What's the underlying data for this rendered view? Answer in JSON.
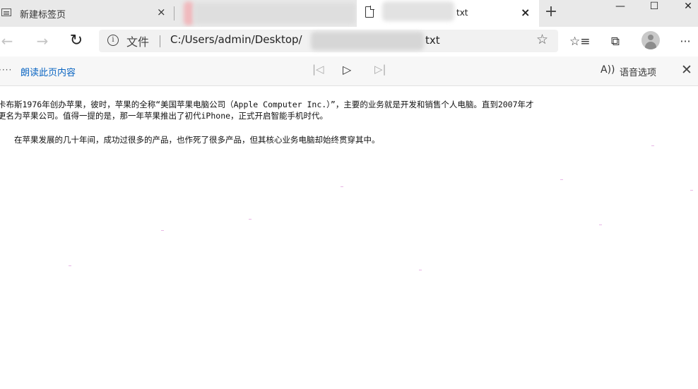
{
  "tabs": [
    {
      "title": "新建标签页",
      "close": "×"
    },
    {
      "title": ""
    },
    {
      "title": "txt",
      "close": "×"
    }
  ],
  "new_tab": "+",
  "window_controls": {
    "minimize": "—",
    "maximize": "☐",
    "close": "✕"
  },
  "toolbar": {
    "back": "←",
    "forward": "→",
    "refresh": "↻",
    "info": "i",
    "file_label": "文件",
    "url": "C:/Users/admin/Desktop/",
    "url_suffix": "txt",
    "star": "☆",
    "favorites": "☆≡",
    "collections": "⧉",
    "more": "···"
  },
  "reader": {
    "dots": "····",
    "read_aloud": "朗读此页内容",
    "prev": "|◁",
    "play": "▷",
    "next": "▷|",
    "voice_icon": "A))",
    "voice_options": "语音选项",
    "close": "✕"
  },
  "content": {
    "line1": "卡布斯1976年创办苹果，彼时，苹果的全称“美国苹果电脑公司（Apple Computer Inc.）”，主要的业务就是开发和销售个人电脑。直到2007年才",
    "line2": "更名为苹果公司。值得一提的是，那一年苹果推出了初代iPhone，正式开启智能手机时代。",
    "line3": "在苹果发展的几十年间，成功过很多的产品，也作死了很多产品，但其核心业务电脑却始终贯穿其中。"
  },
  "colors": {
    "accent": "#0a65c2",
    "tabstrip": "#e9e9e9",
    "reader_bar": "#f7f7f7"
  }
}
